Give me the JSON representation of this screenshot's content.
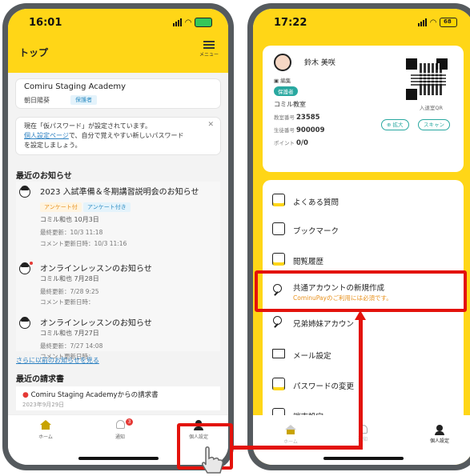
{
  "left_phone": {
    "time": "16:01",
    "header_title": "トップ",
    "menu_label": "メニュー",
    "academy": {
      "name": "Comiru Staging Academy",
      "user": "朝日陽葵",
      "role": "保護者"
    },
    "notice": {
      "line1": "現在「仮パスワード」が設定されています。",
      "link": "個人設定ページ",
      "line2": "で、自分で覚えやすい新しいパスワード",
      "line3": "を設定しましょう。"
    },
    "news_heading": "最近のお知らせ",
    "news": [
      {
        "title": "2023 入試準備＆冬期講習説明会のお知らせ",
        "tags": [
          "アンケート付",
          "アンケート付き"
        ],
        "meta": "コミル和也 10月3日",
        "updated": "最終更新：10/3 11:18",
        "comment": "コメント更新日時：10/3 11:16"
      },
      {
        "title": "オンラインレッスンのお知らせ",
        "meta": "コミル和也 7月28日",
        "updated": "最終更新：7/28 9:25",
        "comment": "コメント更新日時："
      },
      {
        "title": "オンラインレッスンのお知らせ",
        "meta": "コミル和也 7月27日",
        "updated": "最終更新：7/27 14:08",
        "comment": "コメント更新日時："
      }
    ],
    "more_link": "さらに以前のお知らせを見る",
    "invoice_heading": "最近の請求書",
    "invoice": {
      "title": "Comiru Staging Academyからの請求書",
      "date": "2023年9月29日"
    },
    "tabs": {
      "home": "ホーム",
      "notify": "通知",
      "notify_count": "3",
      "personal": "個人設定"
    }
  },
  "right_phone": {
    "time": "17:22",
    "profile": {
      "name": "鈴木 美咲",
      "edit": "編集",
      "role": "保護者",
      "school": "コミル教室",
      "classroom_no_label": "教室番号",
      "classroom_no": "23585",
      "student_no_label": "生徒番号",
      "student_no": "900009",
      "points_label": "ポイント",
      "points": "0/0",
      "qr_label": "入退室QR",
      "zoom": "拡大",
      "scan": "スキャン"
    },
    "menu": [
      {
        "label": "よくある質問",
        "icon": "faq-icon"
      },
      {
        "label": "ブックマーク",
        "icon": "bookmark-icon"
      },
      {
        "label": "閲覧履歴",
        "icon": "history-icon"
      },
      {
        "label": "共通アカウントの新規作成",
        "sub": "CominuPayのご利用には必須です。",
        "icon": "user-add-icon"
      },
      {
        "label": "兄弟姉妹アカウン",
        "icon": "siblings-icon"
      },
      {
        "label": "メール設定",
        "icon": "mail-icon"
      },
      {
        "label": "パスワードの変更",
        "icon": "lock-icon"
      },
      {
        "label": "端末設定",
        "icon": "device-icon"
      }
    ],
    "tabs": {
      "home": "ホーム",
      "notify": "通知",
      "personal": "個人設定"
    }
  },
  "colors": {
    "brand_yellow": "#ffd617",
    "highlight_red": "#e3120b",
    "teal": "#29a8a0",
    "link_blue": "#2a7fc1"
  }
}
